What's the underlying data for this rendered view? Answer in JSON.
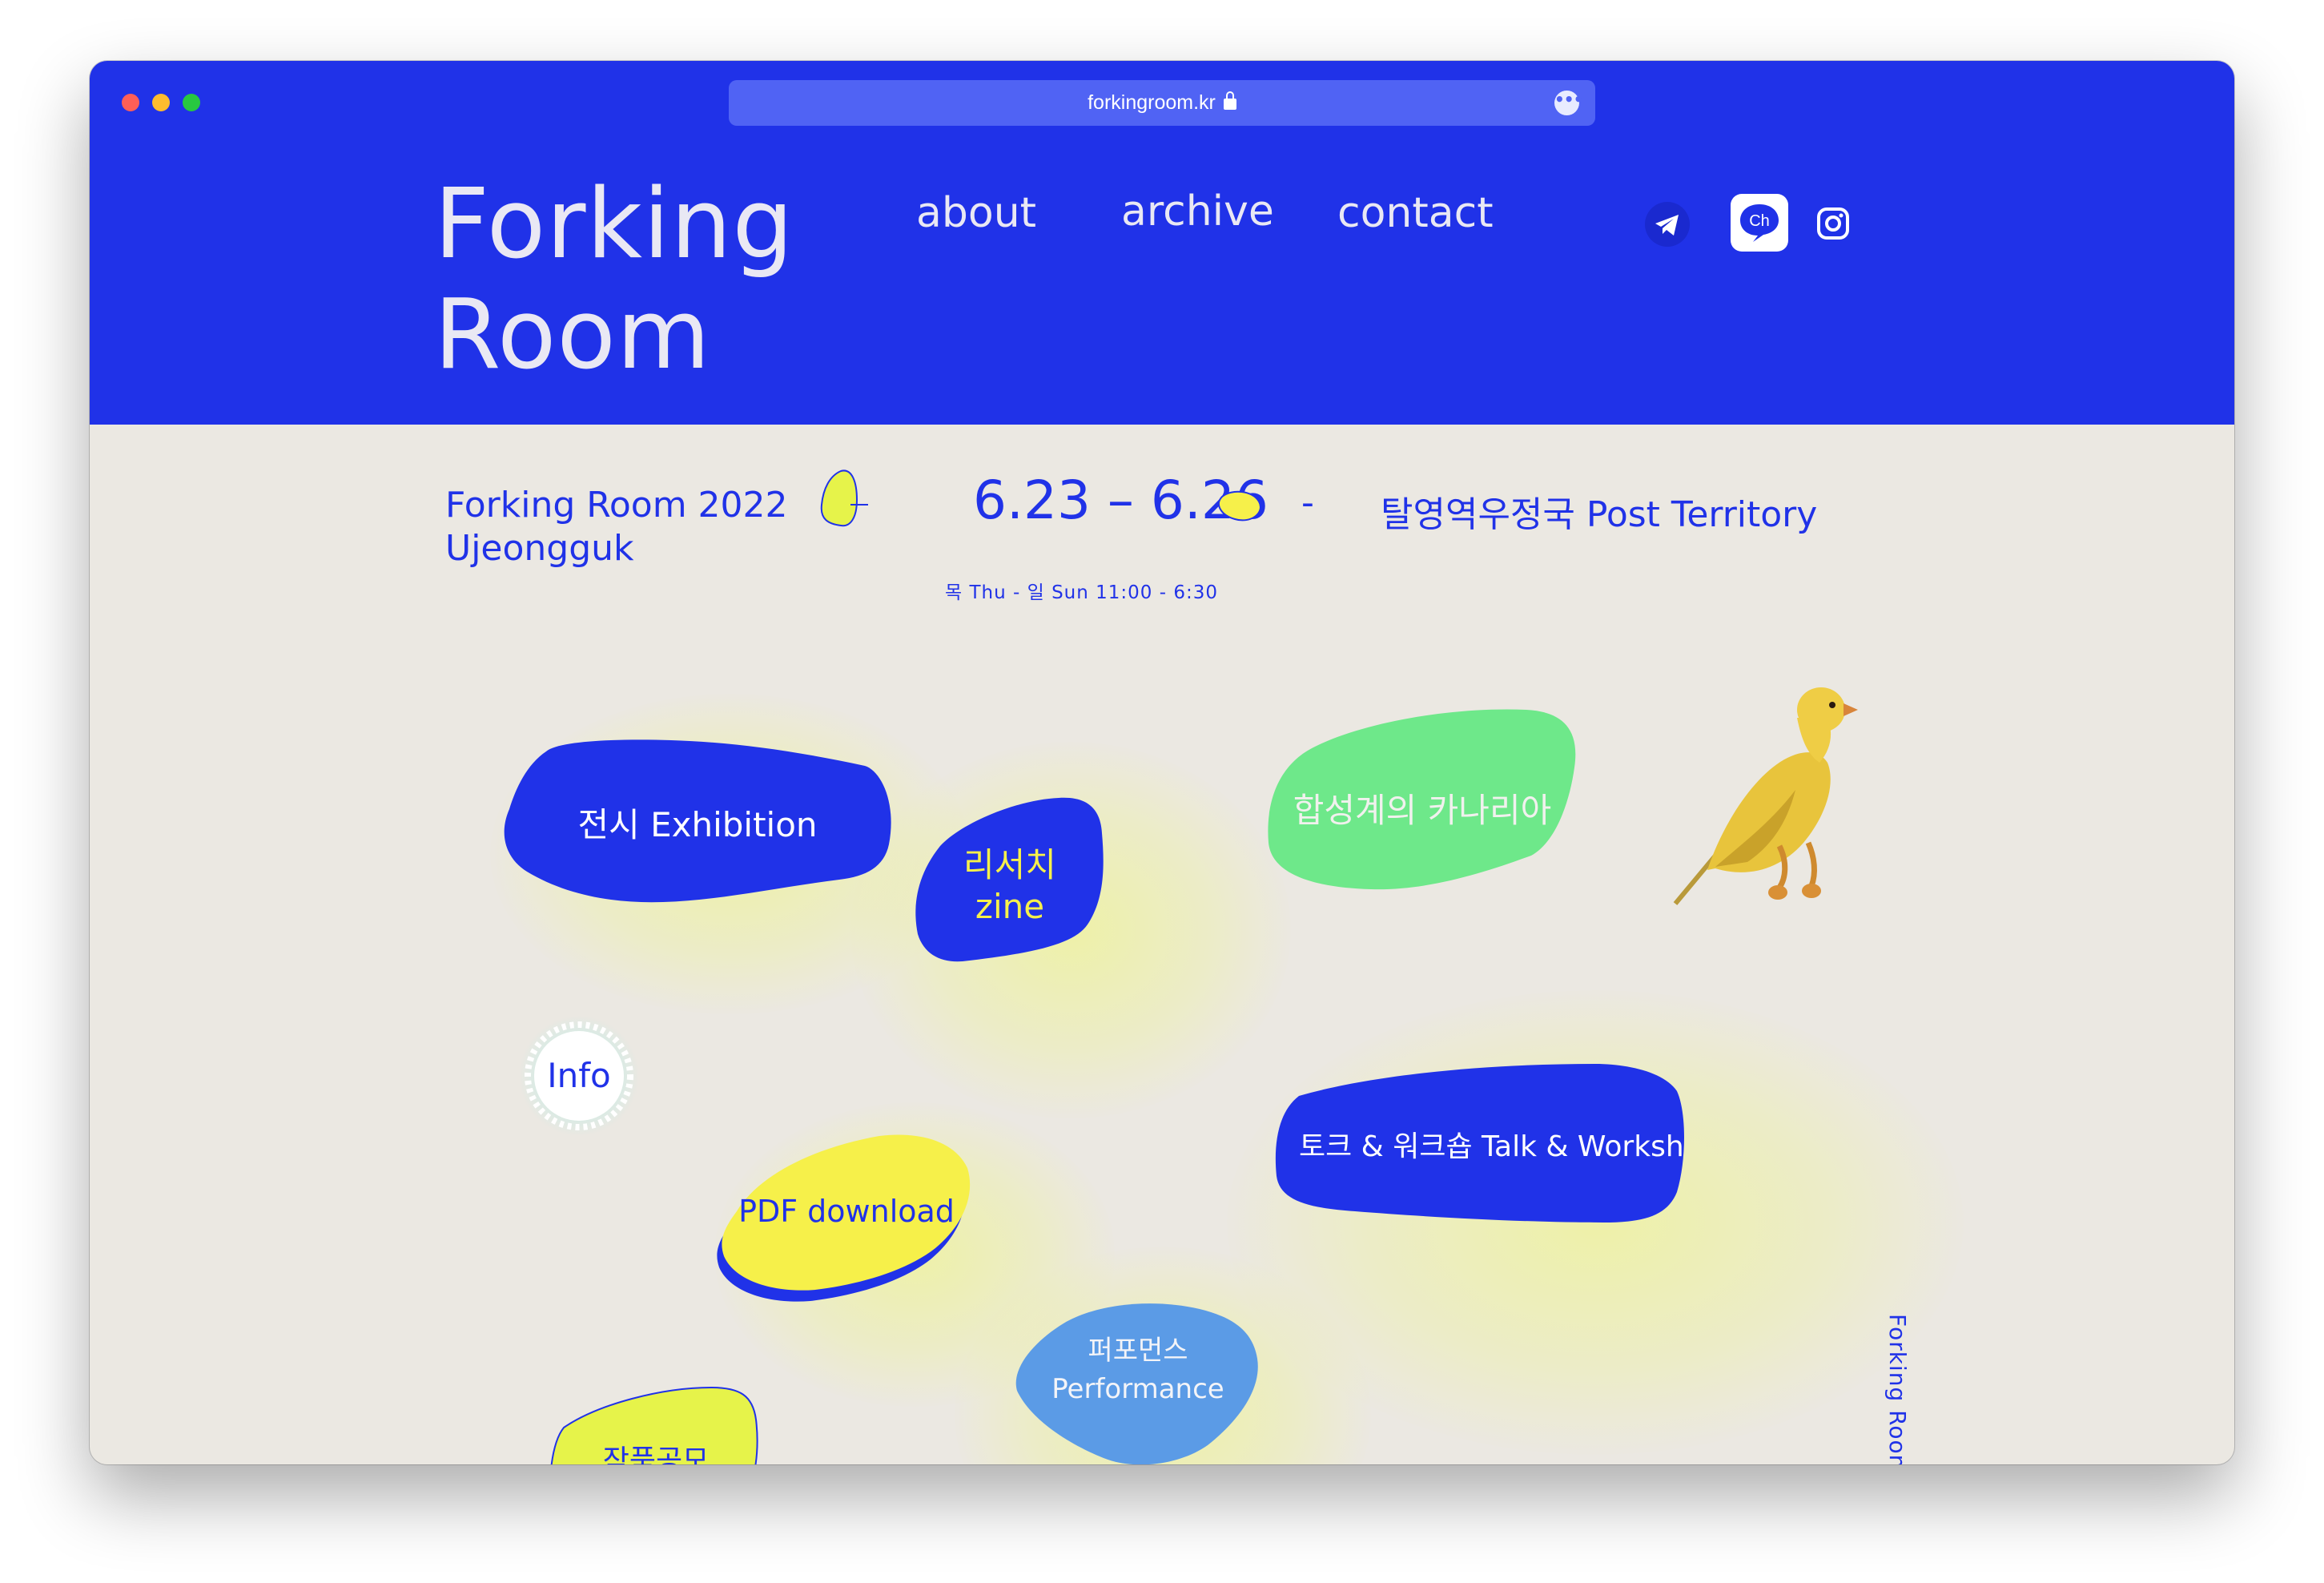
{
  "browser": {
    "url": "forkingroom.kr",
    "lights": {
      "close": "#fe5f57",
      "minimize": "#febc2e",
      "zoom": "#28c840"
    }
  },
  "colors": {
    "brand_blue": "#2032e8",
    "background": "#ebe8e2",
    "yellow": "#f6f04a",
    "lime": "#e6f34a",
    "green": "#6ee88a",
    "sky": "#5b9be6"
  },
  "header": {
    "logo_line1": "Forking",
    "logo_line2": "Room",
    "nav": {
      "about": "about",
      "archive": "archive",
      "contact": "contact"
    },
    "social": {
      "telegram_icon": "telegram-icon",
      "kakao_icon_text": "Ch",
      "instagram_icon": "instagram-icon"
    }
  },
  "event": {
    "title_line1": "Forking Room 2022",
    "title_line2": "Ujeongguk",
    "dates": "6.23 – 6.26",
    "dash": "-",
    "venue": "탈영역우정국  Post Territory",
    "hours": "목 Thu - 일 Sun 11:00 - 6:30"
  },
  "menu": {
    "exhibition": "전시 Exhibition",
    "zine_line1": "리서치",
    "zine_line2": "zine",
    "canary": "합성계의 카나리아",
    "info": "Info",
    "talk": "토크 & 워크숍 Talk & Workshop",
    "pdf": "PDF download",
    "performance_line1": "퍼포먼스",
    "performance_line2": "Performance",
    "open_call": "작품공모"
  },
  "sidebar_vertical": "Forking Room"
}
